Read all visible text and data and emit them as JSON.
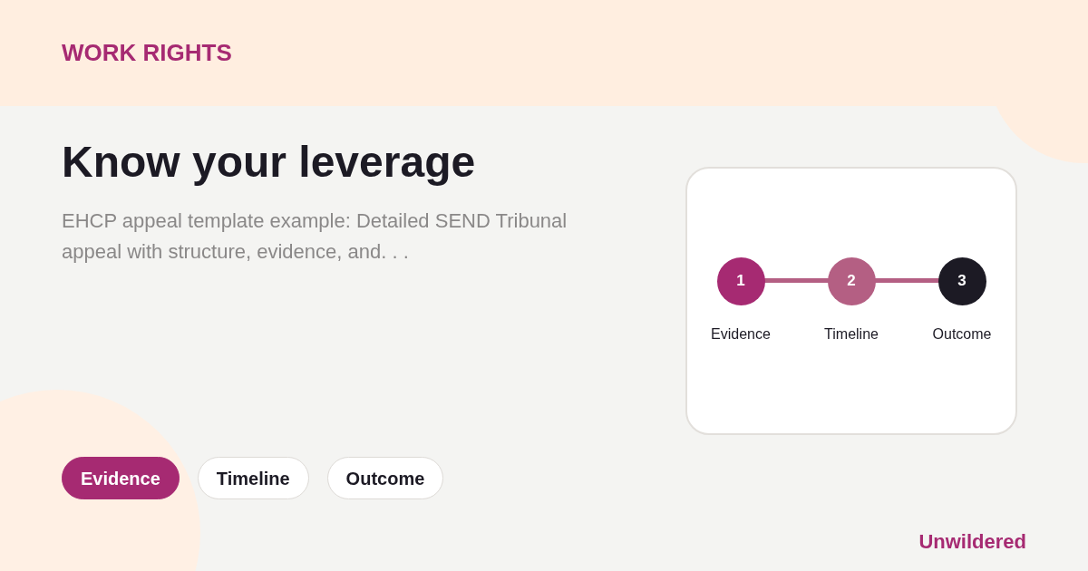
{
  "eyebrow": "WORK RIGHTS",
  "title": "Know your leverage",
  "description": "EHCP appeal template example: Detailed SEND Tribunal appeal with structure, evidence, and. . .",
  "steps": [
    {
      "number": "1",
      "label": "Evidence",
      "color": "#a62a72"
    },
    {
      "number": "2",
      "label": "Timeline",
      "color": "#b45f83"
    },
    {
      "number": "3",
      "label": "Outcome",
      "color": "#1c1a24"
    }
  ],
  "pills": [
    {
      "label": "Evidence",
      "selected": true
    },
    {
      "label": "Timeline",
      "selected": false
    },
    {
      "label": "Outcome",
      "selected": false
    }
  ],
  "brand": "Unwildered"
}
